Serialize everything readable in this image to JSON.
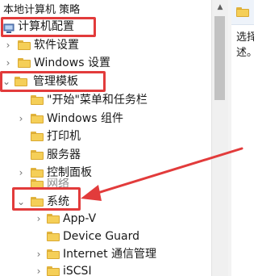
{
  "tree": {
    "root_label": "本地计算机 策略",
    "computer_config_label": "计算机配置",
    "software_settings_label": "软件设置",
    "windows_settings_label": "Windows 设置",
    "admin_templates_label": "管理模板",
    "start_menu_label": "\"开始\"菜单和任务栏",
    "windows_components_label": "Windows 组件",
    "printers_label": "打印机",
    "server_label": "服务器",
    "control_panel_label": "控制面板",
    "network_label": "网络",
    "system_label": "系统",
    "appv_label": "App-V",
    "device_guard_label": "Device Guard",
    "internet_comm_label": "Internet 通信管理",
    "iscsi_label": "iSCSI"
  },
  "right_pane": {
    "line1": "选择",
    "line2": "述。"
  },
  "annotations": {
    "highlight_color": "#e23b3b"
  }
}
